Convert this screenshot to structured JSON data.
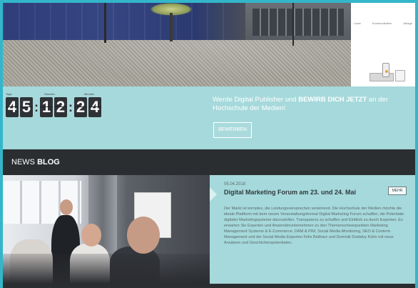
{
  "countdown": {
    "labels": [
      "Tage",
      "Stunden",
      "Minuten"
    ],
    "digits": [
      "4",
      "5",
      "1",
      "2",
      "2",
      "4"
    ]
  },
  "recruit": {
    "text_before": "Werde Digital Publisher und ",
    "text_bold": "BEWIRB DICH JETZT",
    "text_after": " an der Hochschule der Medien!",
    "button_label": "BEWERBEN"
  },
  "news_section": {
    "title_light": "NEWS ",
    "title_bold": "BLOG"
  },
  "news_item": {
    "date": "05.04.2018",
    "title": "Digital Marketing Forum am 23. und 24. Mai",
    "more_label": "MEHR",
    "body": "Der Markt ist komplex, die Leistungsversprechen verwirrend. Die Hochschule der Medien möchte die ideale Plattform mit dem neuen Veranstaltungsformat Digital Marketing Forum schaffen, die Potentiale digitaler Marketingsysteme darzustellen. Transparenz zu schaffen und Einblick zu durch Experten. Es erwarten Sie Experten und Anwenderunternehmen zu den Themenschwerpunkten Marketing Management Systeme & E-Commerce, DAM & PIM, Social Media Monitoring, SEO & Content-Management und die Social Media Experten Felix Beilharz und Dominik Dodaloy Kühn mit neue Ansätzen und Geschichtenpotentialen."
  },
  "hero_side": {
    "tabs": [
      "Lokal",
      "Kommunikation",
      "Ablage"
    ]
  },
  "colors": {
    "accent": "#33b6c9",
    "background": "#a6d9db",
    "dark_bar": "#2b2e31",
    "digit_bg": "#2e3236"
  }
}
